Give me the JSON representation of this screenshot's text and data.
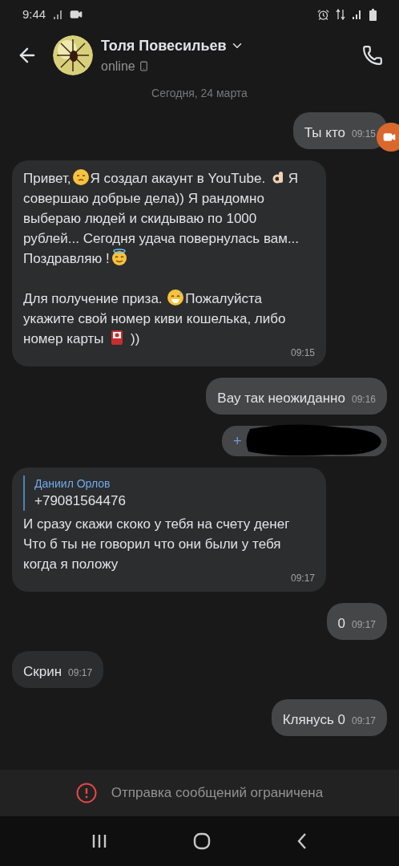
{
  "status_bar": {
    "time": "9:44"
  },
  "header": {
    "name": "Толя Повесильев",
    "status": "online"
  },
  "date": "Сегодня, 24 марта",
  "messages": [
    {
      "incoming": false,
      "kind": "text",
      "parts": [
        {
          "kind": "text",
          "text": "Ты кто"
        }
      ],
      "time": "09:15"
    },
    {
      "incoming": true,
      "kind": "text",
      "parts": [
        {
          "kind": "text",
          "text": "Привет,"
        },
        {
          "kind": "face"
        },
        {
          "kind": "text",
          "text": "Я создал акаунт в YouTube. "
        },
        {
          "kind": "hand"
        },
        {
          "kind": "text",
          "text": "Я совершаю добрые дела)) Я рандомно выбераю людей и скидываю по 1000 рублей... Сегодня удача повернулась вам... Поздравляю !"
        },
        {
          "kind": "halo"
        },
        {
          "kind": "break"
        },
        {
          "kind": "break"
        },
        {
          "kind": "text",
          "text": "Для получение приза. "
        },
        {
          "kind": "sweat"
        },
        {
          "kind": "text",
          "text": "Пожалуйста укажите свой номер киви кошелька, либо номер карты "
        },
        {
          "kind": "card"
        },
        {
          "kind": "text",
          "text": " ))"
        }
      ],
      "time": "09:15"
    },
    {
      "incoming": false,
      "kind": "text",
      "parts": [
        {
          "kind": "text",
          "text": "Вау так неожиданно"
        }
      ],
      "time": "09:16"
    },
    {
      "incoming": false,
      "kind": "redacted",
      "parts": [
        {
          "kind": "text",
          "text": "+"
        }
      ]
    },
    {
      "incoming": true,
      "kind": "forwarded",
      "author": "Даниил Орлов",
      "quote": "+79081564476",
      "parts": [
        {
          "kind": "text",
          "text": "И сразу скажи скоко у тебя на счету денег"
        },
        {
          "kind": "break"
        },
        {
          "kind": "text",
          "text": "Что б ты не говорил что они были у тебя когда я положу"
        }
      ],
      "time": "09:17"
    },
    {
      "incoming": false,
      "kind": "text",
      "parts": [
        {
          "kind": "text",
          "text": "0"
        }
      ],
      "time": "09:17"
    },
    {
      "incoming": true,
      "kind": "text",
      "parts": [
        {
          "kind": "text",
          "text": "Скрин"
        }
      ],
      "time": "09:17"
    },
    {
      "incoming": false,
      "kind": "text",
      "parts": [
        {
          "kind": "text",
          "text": "Клянусь 0"
        }
      ],
      "time": "09:17"
    }
  ],
  "notice": "Отправка сообщений ограничена"
}
